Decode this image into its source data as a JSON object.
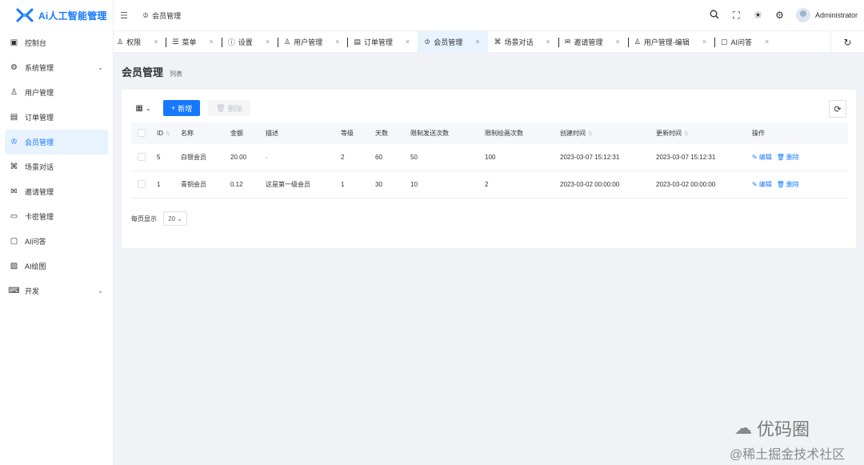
{
  "app": {
    "logo_text": "Ai人工智能管理",
    "brand_color": "#1677ff"
  },
  "sidebar": {
    "items": [
      {
        "label": "控制台",
        "icon": "dashboard-icon",
        "glyph": "▣",
        "arrow": ""
      },
      {
        "label": "系统管理",
        "icon": "gear-icon",
        "glyph": "⚙",
        "arrow": "⌄"
      },
      {
        "label": "用户管理",
        "icon": "user-icon",
        "glyph": "♙",
        "arrow": ""
      },
      {
        "label": "订单管理",
        "icon": "order-icon",
        "glyph": "▤",
        "arrow": ""
      },
      {
        "label": "会员管理",
        "icon": "crown-icon",
        "glyph": "♔",
        "arrow": "",
        "active": true
      },
      {
        "label": "场景对话",
        "icon": "robot-icon",
        "glyph": "⌘",
        "arrow": ""
      },
      {
        "label": "邀请管理",
        "icon": "mail-icon",
        "glyph": "✉",
        "arrow": ""
      },
      {
        "label": "卡密管理",
        "icon": "monitor-icon",
        "glyph": "▭",
        "arrow": ""
      },
      {
        "label": "AI问答",
        "icon": "chat-icon",
        "glyph": "▢",
        "arrow": ""
      },
      {
        "label": "AI绘图",
        "icon": "image-icon",
        "glyph": "▨",
        "arrow": ""
      },
      {
        "label": "开发",
        "icon": "code-icon",
        "glyph": "⌨",
        "arrow": "⌄"
      }
    ]
  },
  "header": {
    "fold_glyph": "☰",
    "breadcrumb": "会员管理",
    "username": "Administrator"
  },
  "tabs": {
    "items": [
      {
        "label": "权限",
        "glyph": "♙",
        "active": false
      },
      {
        "label": "菜单",
        "glyph": "☰",
        "active": false
      },
      {
        "label": "设置",
        "glyph": "ⓘ",
        "active": false
      },
      {
        "label": "用户管理",
        "glyph": "♙",
        "active": false
      },
      {
        "label": "订单管理",
        "glyph": "▤",
        "active": false
      },
      {
        "label": "会员管理",
        "glyph": "♔",
        "active": true
      },
      {
        "label": "场景对话",
        "glyph": "⌘",
        "active": false
      },
      {
        "label": "邀请管理",
        "glyph": "✉",
        "active": false
      },
      {
        "label": "用户管理-编辑",
        "glyph": "♙",
        "active": false
      },
      {
        "label": "AI问答",
        "glyph": "▢",
        "active": false
      }
    ],
    "close_glyph": "×"
  },
  "page": {
    "title": "会员管理",
    "subtitle": "列表"
  },
  "toolbar": {
    "add_label": "新增",
    "delete_label": "删除"
  },
  "table": {
    "columns": [
      "ID",
      "名称",
      "金额",
      "描述",
      "等级",
      "天数",
      "限制发送次数",
      "限制绘画次数",
      "创建时间",
      "更新时间",
      "操作"
    ],
    "rows": [
      {
        "id": "5",
        "name": "白银会员",
        "amount": "20.00",
        "desc": "-",
        "level": "2",
        "days": "60",
        "send_limit": "50",
        "draw_limit": "100",
        "created": "2023-03-07 15:12:31",
        "updated": "2023-03-07 15:12:31"
      },
      {
        "id": "1",
        "name": "青铜会员",
        "amount": "0.12",
        "desc": "这是第一级会员",
        "level": "1",
        "days": "30",
        "send_limit": "10",
        "draw_limit": "2",
        "created": "2023-03-02 00:00:00",
        "updated": "2023-03-02 00:00:00"
      }
    ],
    "edit_label": "编辑",
    "delete_label": "删除"
  },
  "pager": {
    "label": "每页显示",
    "page_size": "20"
  },
  "watermark": {
    "line1": "优码圈",
    "line2": "@稀土掘金技术社区"
  }
}
